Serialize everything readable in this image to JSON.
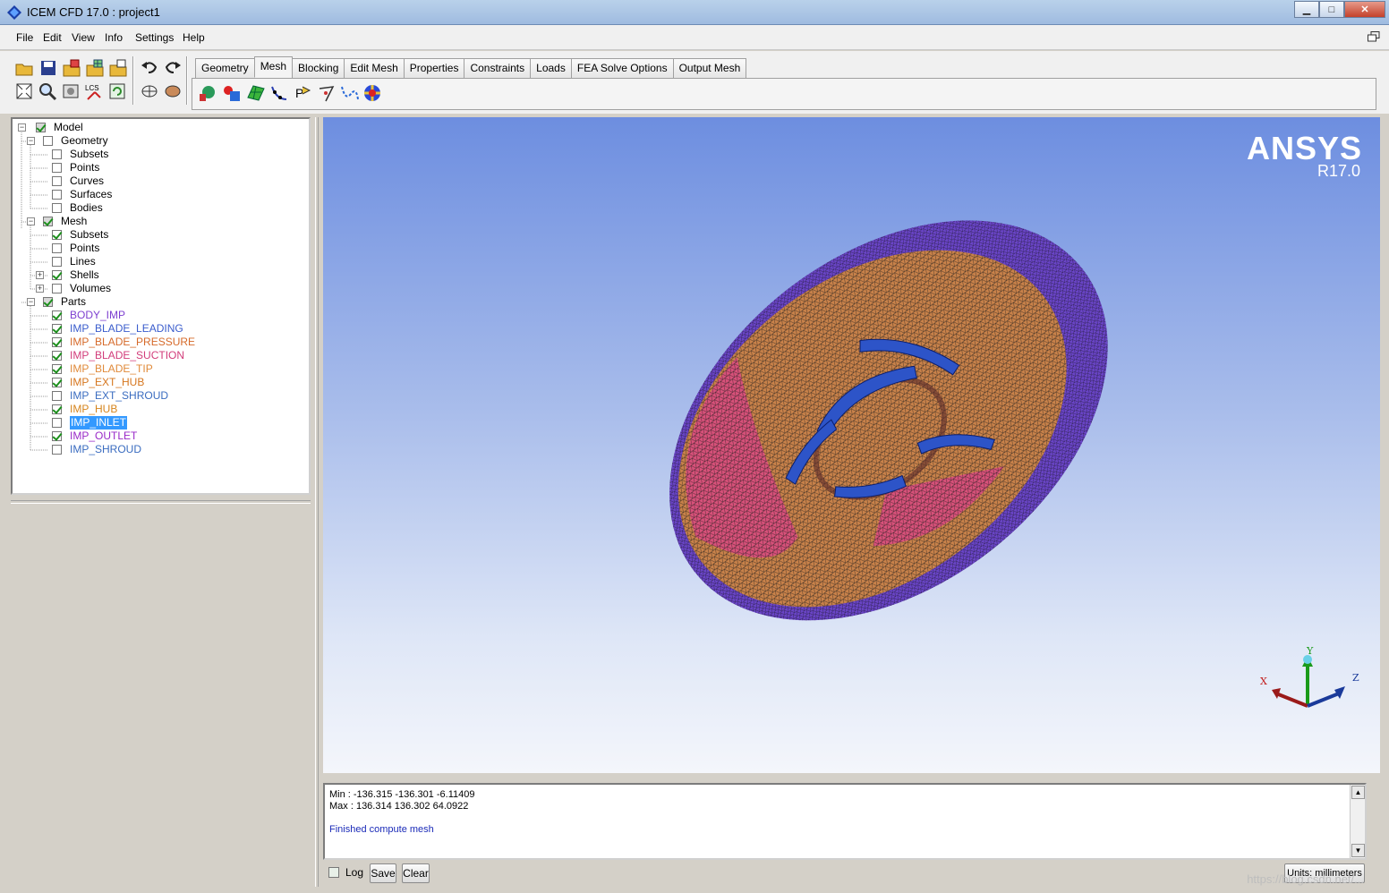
{
  "window": {
    "title": "ICEM CFD 17.0 : project1",
    "minimize": "▁",
    "maximize": "□",
    "close": "✕"
  },
  "menu": [
    "File",
    "Edit",
    "View",
    "Info",
    "Settings",
    "Help"
  ],
  "tabs": [
    "Geometry",
    "Mesh",
    "Blocking",
    "Edit Mesh",
    "Properties",
    "Constraints",
    "Loads",
    "FEA Solve Options",
    "Output Mesh"
  ],
  "active_tab": "Mesh",
  "tree": {
    "model": "Model",
    "geometry": {
      "label": "Geometry",
      "items": [
        "Subsets",
        "Points",
        "Curves",
        "Surfaces",
        "Bodies"
      ]
    },
    "mesh": {
      "label": "Mesh",
      "items": [
        "Subsets",
        "Points",
        "Lines",
        "Shells",
        "Volumes"
      ]
    },
    "parts": {
      "label": "Parts",
      "items": [
        {
          "name": "BODY_IMP",
          "checked": true,
          "color": "#7d3fd0"
        },
        {
          "name": "IMP_BLADE_LEADING",
          "checked": true,
          "color": "#3a5ccc"
        },
        {
          "name": "IMP_BLADE_PRESSURE",
          "checked": true,
          "color": "#d66a2a"
        },
        {
          "name": "IMP_BLADE_SUCTION",
          "checked": true,
          "color": "#d23c7a"
        },
        {
          "name": "IMP_BLADE_TIP",
          "checked": true,
          "color": "#e08a3a"
        },
        {
          "name": "IMP_EXT_HUB",
          "checked": true,
          "color": "#d6761e"
        },
        {
          "name": "IMP_EXT_SHROUD",
          "checked": false,
          "color": "#3a6cc0"
        },
        {
          "name": "IMP_HUB",
          "checked": true,
          "color": "#d6851e"
        },
        {
          "name": "IMP_INLET",
          "checked": false,
          "color": "#ffffff",
          "selected": true
        },
        {
          "name": "IMP_OUTLET",
          "checked": true,
          "color": "#9a2ac8"
        },
        {
          "name": "IMP_SHROUD",
          "checked": false,
          "color": "#3a6cc0"
        }
      ]
    }
  },
  "viewport": {
    "logo": "ANSYS",
    "version": "R17.0",
    "axis_x": "X",
    "axis_y": "Y",
    "axis_z": "Z"
  },
  "messages": {
    "min": "Min : -136.315 -136.301 -6.11409",
    "max": "Max : 136.314 136.302 64.0922",
    "status": "Finished compute mesh"
  },
  "bottom": {
    "log": "Log",
    "save": "Save",
    "clear": "Clear",
    "units": "Units: millimeters"
  },
  "watermark": "https://blog.csdn.net/...",
  "colors": {
    "mesh_orange": "#c9824a",
    "mesh_pink": "#d8517a",
    "mesh_purple": "#6a45c8",
    "blade_blue": "#2d54c8"
  }
}
